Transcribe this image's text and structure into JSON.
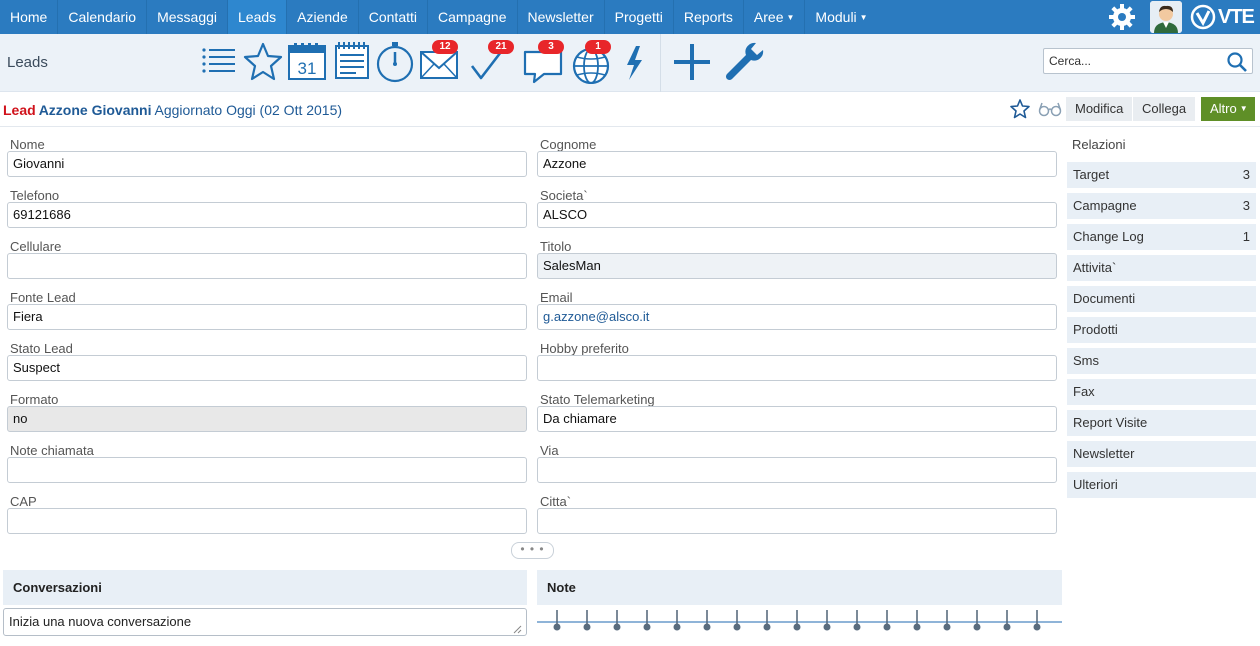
{
  "nav": {
    "items": [
      "Home",
      "Calendario",
      "Messaggi",
      "Leads",
      "Aziende",
      "Contatti",
      "Campagne",
      "Newsletter",
      "Progetti",
      "Reports"
    ],
    "dropdowns": [
      "Aree",
      "Moduli"
    ],
    "active": "Leads",
    "logo_text": "VTE",
    "icons": [
      "gear-icon",
      "avatar",
      "vte-logo"
    ]
  },
  "toolbar": {
    "module_title": "Leads",
    "tools": [
      {
        "name": "list-icon"
      },
      {
        "name": "star-icon"
      },
      {
        "name": "calendar-icon",
        "label": "31"
      },
      {
        "name": "notepad-icon"
      },
      {
        "name": "stopwatch-icon"
      },
      {
        "name": "mail-icon",
        "badge": "12"
      },
      {
        "name": "checkmark-icon",
        "badge": "21"
      },
      {
        "name": "chat-icon",
        "badge": "3"
      },
      {
        "name": "globe-icon",
        "badge": "1"
      },
      {
        "name": "lightning-icon"
      },
      {
        "name": "plus-icon"
      },
      {
        "name": "wrench-icon"
      }
    ],
    "search_placeholder": "Cerca..."
  },
  "record": {
    "type": "Lead",
    "name": "Azzone Giovanni",
    "updated": "Aggiornato Oggi (02 Ott 2015)",
    "buttons": {
      "modify": "Modifica",
      "link": "Collega",
      "more": "Altro"
    }
  },
  "fields_left": [
    {
      "label": "Nome",
      "value": "Giovanni"
    },
    {
      "label": "Telefono",
      "value": "69121686"
    },
    {
      "label": "Cellulare",
      "value": ""
    },
    {
      "label": "Fonte Lead",
      "value": "Fiera"
    },
    {
      "label": "Stato Lead",
      "value": "Suspect"
    },
    {
      "label": "Formato",
      "value": "no"
    },
    {
      "label": "Note chiamata",
      "value": ""
    },
    {
      "label": "CAP",
      "value": ""
    }
  ],
  "fields_right": [
    {
      "label": "Cognome",
      "value": "Azzone"
    },
    {
      "label": "Societa`",
      "value": "ALSCO"
    },
    {
      "label": "Titolo",
      "value": "SalesMan"
    },
    {
      "label": "Email",
      "value": "g.azzone@alsco.it"
    },
    {
      "label": "Hobby preferito",
      "value": ""
    },
    {
      "label": "Stato Telemarketing",
      "value": "Da chiamare"
    },
    {
      "label": "Via",
      "value": ""
    },
    {
      "label": "Citta`",
      "value": ""
    }
  ],
  "more_toggle": "• • •",
  "relations": {
    "title": "Relazioni",
    "items": [
      {
        "label": "Target",
        "count": "3"
      },
      {
        "label": "Campagne",
        "count": "3"
      },
      {
        "label": "Change Log",
        "count": "1"
      },
      {
        "label": "Attivita`",
        "count": ""
      },
      {
        "label": "Documenti",
        "count": ""
      },
      {
        "label": "Prodotti",
        "count": ""
      },
      {
        "label": "Sms",
        "count": ""
      },
      {
        "label": "Fax",
        "count": ""
      },
      {
        "label": "Report Visite",
        "count": ""
      },
      {
        "label": "Newsletter",
        "count": ""
      },
      {
        "label": "Ulteriori",
        "count": ""
      }
    ]
  },
  "conversations": {
    "title": "Conversazioni",
    "input_value": "Inizia una nuova conversazione"
  },
  "notes": {
    "title": "Note"
  },
  "colors": {
    "nav_bg": "#2b7bc0",
    "toolbar_bg": "#ecf2f8",
    "icon_blue": "#1f6fb2",
    "badge_red": "#e8262a",
    "lead_red": "#d0121b",
    "link_blue": "#1f5a96",
    "more_green": "#5f8f27",
    "panel_bg": "#e8eff6"
  }
}
